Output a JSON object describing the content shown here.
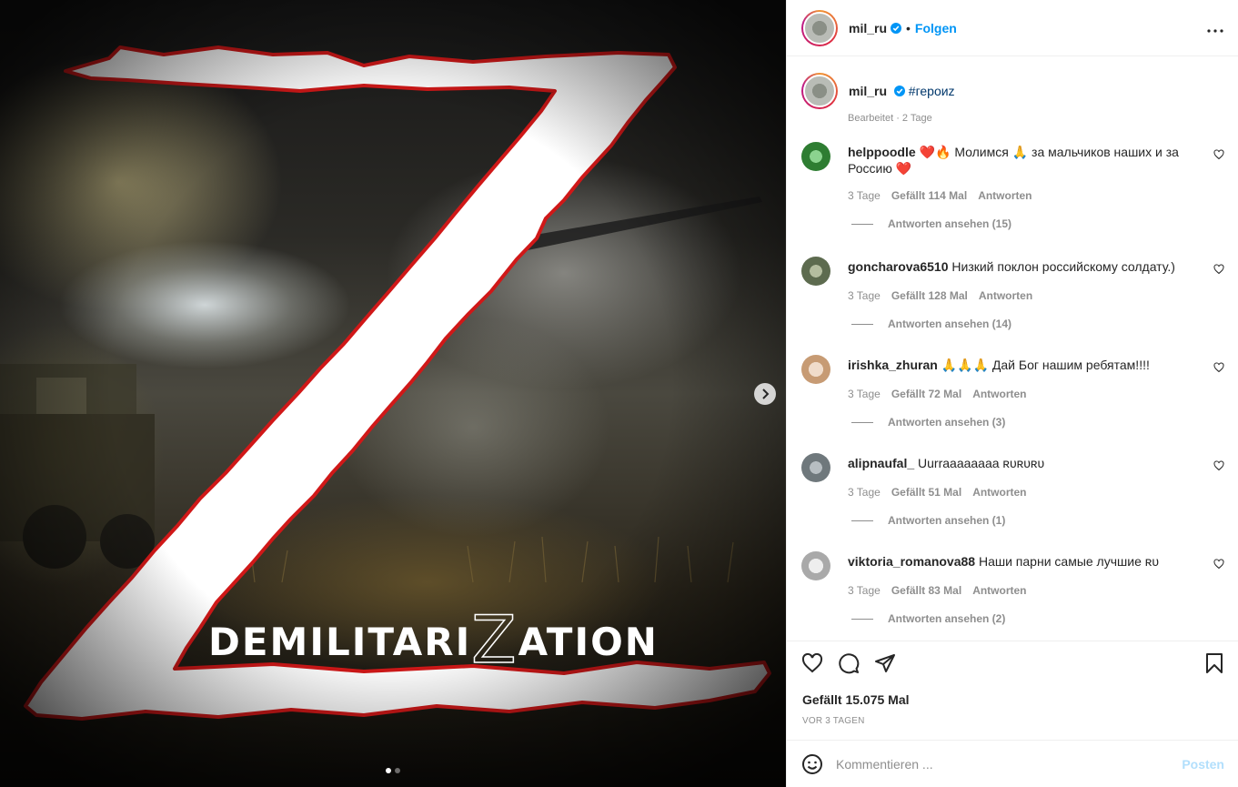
{
  "post_image": {
    "banner_text_left": "DEMILITARI",
    "banner_text_z": "Z",
    "banner_text_right": "ATION",
    "carousel": {
      "dots": 2,
      "active": 1
    }
  },
  "header": {
    "username": "mil_ru",
    "separator": "•",
    "follow_label": "Folgen",
    "more_label": "•••"
  },
  "caption": {
    "username": "mil_ru",
    "hashtag": "#героиz",
    "meta": "Bearbeitet · 2 Tage"
  },
  "comments": [
    {
      "username": "helppoodle",
      "text": "❤️🔥 Молимся 🙏 за мальчиков наших и за Россию ❤️",
      "time": "3 Tage",
      "likes": "Gefällt 114 Mal",
      "reply": "Antworten",
      "view_replies": "Antworten ansehen (15)",
      "avatar_color": "#2e7d32"
    },
    {
      "username": "goncharova6510",
      "text": "Низкий поклон российскому солдату.)",
      "time": "3 Tage",
      "likes": "Gefällt 128 Mal",
      "reply": "Antworten",
      "view_replies": "Antworten ansehen (14)",
      "avatar_color": "#5d6b4f"
    },
    {
      "username": "irishka_zhuran",
      "text": "🙏🙏🙏 Дай Бог нашим ребятам!!!!",
      "time": "3 Tage",
      "likes": "Gefällt 72 Mal",
      "reply": "Antworten",
      "view_replies": "Antworten ansehen (3)",
      "avatar_color": "#d9b89a"
    },
    {
      "username": "alipnaufal_",
      "text": "Uurraaaaaaaa ʀᴜʀᴜʀᴜ",
      "time": "3 Tage",
      "likes": "Gefällt 51 Mal",
      "reply": "Antworten",
      "view_replies": "Antworten ansehen (1)",
      "avatar_color": "#7d8589"
    },
    {
      "username": "viktoria_romanova88",
      "text": "Наши парни самые лучшие ʀᴜ",
      "time": "3 Tage",
      "likes": "Gefällt 83 Mal",
      "reply": "Antworten",
      "view_replies": "Antworten ansehen (2)",
      "avatar_color": "#c8c8c8"
    }
  ],
  "actions": {
    "likes": "Gefällt 15.075 Mal",
    "date": "VOR 3 TAGEN"
  },
  "add_comment": {
    "placeholder": "Kommentieren ...",
    "post_label": "Posten"
  },
  "colors": {
    "link_blue": "#0095f6",
    "post_disabled": "#b2dffc",
    "z_outline": "#d01818",
    "heart_red": "#ed4956"
  }
}
